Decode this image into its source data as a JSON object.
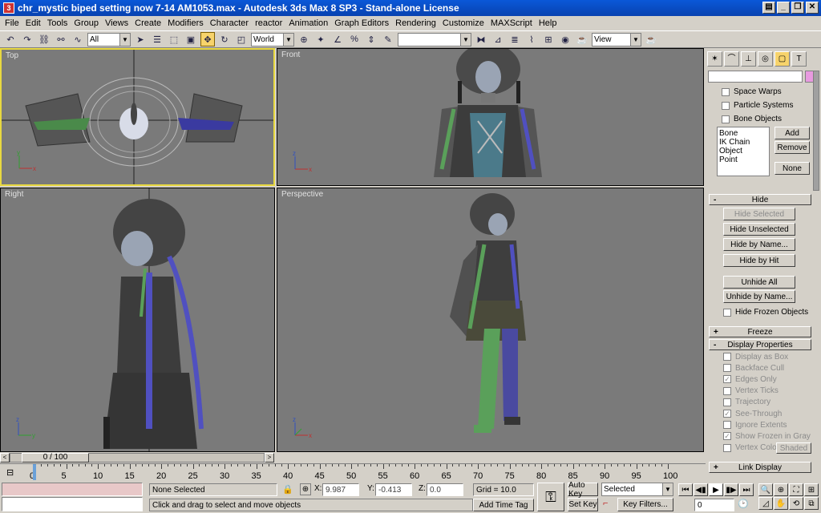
{
  "window": {
    "title": "chr_mystic biped setting now 7-14 AM1053.max - Autodesk 3ds Max 8 SP3  -  Stand-alone License",
    "btns": [
      "▤",
      "_",
      "❐",
      "✕"
    ]
  },
  "menu": [
    "File",
    "Edit",
    "Tools",
    "Group",
    "Views",
    "Create",
    "Modifiers",
    "Character",
    "reactor",
    "Animation",
    "Graph Editors",
    "Rendering",
    "Customize",
    "MAXScript",
    "Help"
  ],
  "toolbar": {
    "selection_filter": "All",
    "ref_coord": "World",
    "named_selection": "",
    "view": "View"
  },
  "viewports": {
    "top": "Top",
    "front": "Front",
    "right": "Right",
    "perspective": "Perspective"
  },
  "axis": {
    "x": "x",
    "y": "y",
    "z": "z"
  },
  "time": {
    "slider": "0 / 100",
    "ticks": [
      0,
      5,
      10,
      15,
      20,
      25,
      30,
      35,
      40,
      45,
      50,
      55,
      60,
      65,
      70,
      75,
      80,
      85,
      90,
      95,
      100
    ]
  },
  "cmd": {
    "checks": [
      "Space Warps",
      "Particle Systems",
      "Bone Objects"
    ],
    "list": [
      "Bone",
      "IK Chain Object",
      "Point"
    ],
    "add": "Add",
    "remove": "Remove",
    "none": "None",
    "hide_title": "Hide",
    "hide_selected": "Hide Selected",
    "hide_unselected": "Hide Unselected",
    "hide_by_name": "Hide by Name...",
    "hide_by_hit": "Hide by Hit",
    "unhide_all": "Unhide All",
    "unhide_by_name": "Unhide by Name...",
    "hide_frozen": "Hide Frozen Objects",
    "freeze": "Freeze",
    "display_props": "Display Properties",
    "props": [
      "Display as Box",
      "Backface Cull",
      "Edges Only",
      "Vertex Ticks",
      "Trajectory",
      "See-Through",
      "Ignore Extents",
      "Show Frozen in Gray",
      "Vertex Colors"
    ],
    "shaded": "Shaded",
    "link_display": "Link Display"
  },
  "status": {
    "selection": "None Selected",
    "prompt": "Click and drag to select and move objects",
    "x_label": "X:",
    "x": "9.987",
    "y_label": "Y:",
    "y": "-0.413",
    "z_label": "Z:",
    "z": "0.0",
    "grid": "Grid = 10.0",
    "add_time_tag": "Add Time Tag",
    "auto_key": "Auto Key",
    "set_key": "Set Key",
    "key_mode": "Selected",
    "key_filters": "Key Filters...",
    "frame": "0"
  }
}
